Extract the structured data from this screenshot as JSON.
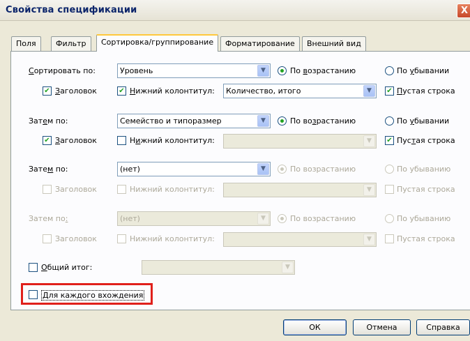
{
  "window": {
    "title": "Свойства спецификации",
    "close_glyph": "X"
  },
  "tabs": [
    {
      "label": "Поля"
    },
    {
      "label": "Фильтр"
    },
    {
      "label": "Сортировка/группирование",
      "active": true
    },
    {
      "label": "Форматирование"
    },
    {
      "label": "Внешний вид"
    }
  ],
  "rows": [
    {
      "label_pre": "",
      "label_u": "С",
      "label_post": "ортировать по:",
      "value": "Уровень",
      "asc_pre": "По ",
      "asc_u": "в",
      "asc_post": "озрастанию",
      "desc_pre": "По ",
      "desc_u": "у",
      "desc_post": "бывании",
      "header_pre": "",
      "header_u": "З",
      "header_post": "аголовок",
      "footer_pre": "",
      "footer_u": "Н",
      "footer_post": "ижний колонтитул:",
      "footer_value": "Количество, итого",
      "blank_pre": "",
      "blank_u": "П",
      "blank_post": "устая строка"
    },
    {
      "label_pre": "Зат",
      "label_u": "е",
      "label_post": "м по:",
      "value": "Семейство и типоразмер",
      "asc_pre": "По во",
      "asc_u": "з",
      "asc_post": "растанию",
      "desc_pre": "По ",
      "desc_u": "у",
      "desc_post": "бывании",
      "header_pre": "",
      "header_u": "З",
      "header_post": "аголовок",
      "footer_pre": "Н",
      "footer_u": "и",
      "footer_post": "жний колонтитул:",
      "footer_value": "",
      "blank_pre": "Пус",
      "blank_u": "т",
      "blank_post": "ая строка"
    },
    {
      "label_pre": "Зате",
      "label_u": "м",
      "label_post": " по:",
      "value": "(нет)",
      "asc": "По возрастанию",
      "desc": "По убыванию",
      "header": "Заголовок",
      "footer": "Нижний колонтитул:",
      "blank": "Пустая строка"
    },
    {
      "label_pre": "Затем по",
      "label_u": ":",
      "label_post": "",
      "value": "(нет)",
      "asc": "По возрастанию",
      "desc": "По убыванию",
      "header": "Заголовок",
      "footer": "Нижний колонтитул:",
      "blank": "Пустая строка"
    }
  ],
  "grand_total": {
    "label_pre": "",
    "label_u": "О",
    "label_post": "бщий итог:",
    "value": ""
  },
  "each_instance": {
    "label_pre": "",
    "label_u": "Д",
    "label_post": "ля каждого вхождения"
  },
  "buttons": {
    "ok": "ОК",
    "cancel": "Отмена",
    "help": "Справка"
  },
  "glyphs": {
    "check": "✔",
    "arrow": "▼"
  },
  "colors": {
    "highlight": "#e0201b",
    "active_tab": "#ffc83c",
    "check": "#21a121"
  }
}
